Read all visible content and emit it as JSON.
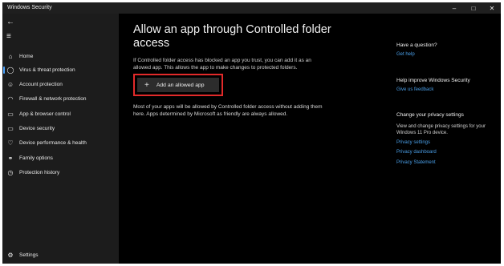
{
  "window": {
    "title": "Windows Security",
    "minimize": "–",
    "maximize": "□",
    "close": "✕"
  },
  "sidebar": {
    "back_icon": "back-arrow-icon",
    "menu_icon": "hamburger-menu-icon",
    "items": [
      {
        "label": "Home",
        "icon": "home-icon"
      },
      {
        "label": "Virus & threat protection",
        "icon": "shield-icon"
      },
      {
        "label": "Account protection",
        "icon": "person-icon"
      },
      {
        "label": "Firewall & network protection",
        "icon": "wifi-icon"
      },
      {
        "label": "App & browser control",
        "icon": "app-window-icon"
      },
      {
        "label": "Device security",
        "icon": "laptop-icon"
      },
      {
        "label": "Device performance & health",
        "icon": "heart-icon"
      },
      {
        "label": "Family options",
        "icon": "family-icon"
      },
      {
        "label": "Protection history",
        "icon": "history-icon"
      }
    ],
    "settings": {
      "label": "Settings",
      "icon": "gear-icon"
    }
  },
  "main": {
    "heading": "Allow an app through Controlled folder access",
    "description": "If Controlled folder access has blocked an app you trust, you can add it as an allowed app. This allows the app to make changes to protected folders.",
    "add_button": "Add an allowed app",
    "note": "Most of your apps will be allowed by Controlled folder access without adding them here. Apps determined by Microsoft as friendly are always allowed."
  },
  "right": {
    "question_heading": "Have a question?",
    "get_help": "Get help",
    "improve_heading": "Help improve Windows Security",
    "feedback": "Give us feedback",
    "privacy_heading": "Change your privacy settings",
    "privacy_text": "View and change privacy settings for your Windows 11 Pro device.",
    "privacy_settings": "Privacy settings",
    "privacy_dashboard": "Privacy dashboard",
    "privacy_statement": "Privacy Statement"
  }
}
